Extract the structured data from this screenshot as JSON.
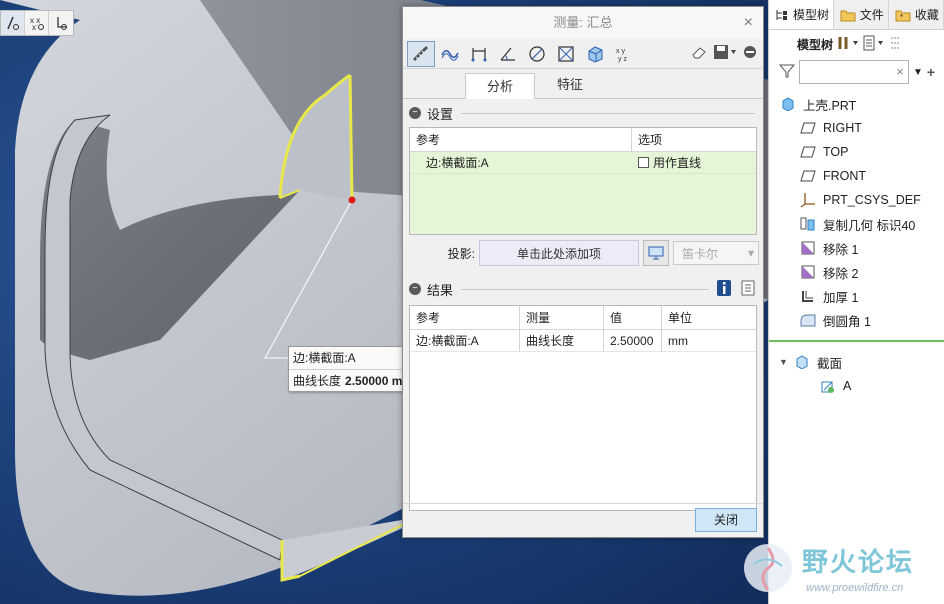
{
  "viewport": {
    "callout": {
      "edge_label": "边:横截面:A",
      "measure_label": "曲线长度",
      "measure_value": "2.50000 m"
    }
  },
  "dialog": {
    "title": "测量: 汇总",
    "close_glyph": "×",
    "tabs": [
      "分析",
      "特征"
    ],
    "settings": {
      "header": "设置",
      "columns": [
        "参考",
        "选项"
      ],
      "row": {
        "ref": "边:横截面:A",
        "option": "用作直线"
      }
    },
    "projection": {
      "label": "投影:",
      "placeholder": "单击此处添加项",
      "coord_system": "笛卡尔"
    },
    "results": {
      "header": "结果",
      "columns": [
        "参考",
        "测量",
        "值",
        "单位"
      ],
      "rows": [
        {
          "ref": "边:横截面:A",
          "measure": "曲线长度",
          "value": "2.50000",
          "unit": "mm"
        }
      ]
    },
    "close_button": "关闭"
  },
  "tree": {
    "tabs": [
      "模型树",
      "文件",
      "收藏"
    ],
    "toolbar_label": "模型树",
    "items": [
      {
        "label": "上壳.PRT",
        "icon": "part-icon",
        "level": 0
      },
      {
        "label": "RIGHT",
        "icon": "datum-plane-icon",
        "level": 1
      },
      {
        "label": "TOP",
        "icon": "datum-plane-icon",
        "level": 1
      },
      {
        "label": "FRONT",
        "icon": "datum-plane-icon",
        "level": 1
      },
      {
        "label": "PRT_CSYS_DEF",
        "icon": "csys-icon",
        "level": 1
      },
      {
        "label": "复制几何 标识40",
        "icon": "copy-geom-icon",
        "level": 1
      },
      {
        "label": "移除 1",
        "icon": "remove-icon",
        "level": 1
      },
      {
        "label": "移除 2",
        "icon": "remove-icon",
        "level": 1
      },
      {
        "label": "加厚 1",
        "icon": "thicken-icon",
        "level": 1
      },
      {
        "label": "倒圆角 1",
        "icon": "round-icon",
        "level": 1
      }
    ],
    "sections": {
      "label": "截面",
      "child": "A"
    }
  },
  "watermark": {
    "text": "野火论坛",
    "url": "www.proewildfire.cn"
  }
}
